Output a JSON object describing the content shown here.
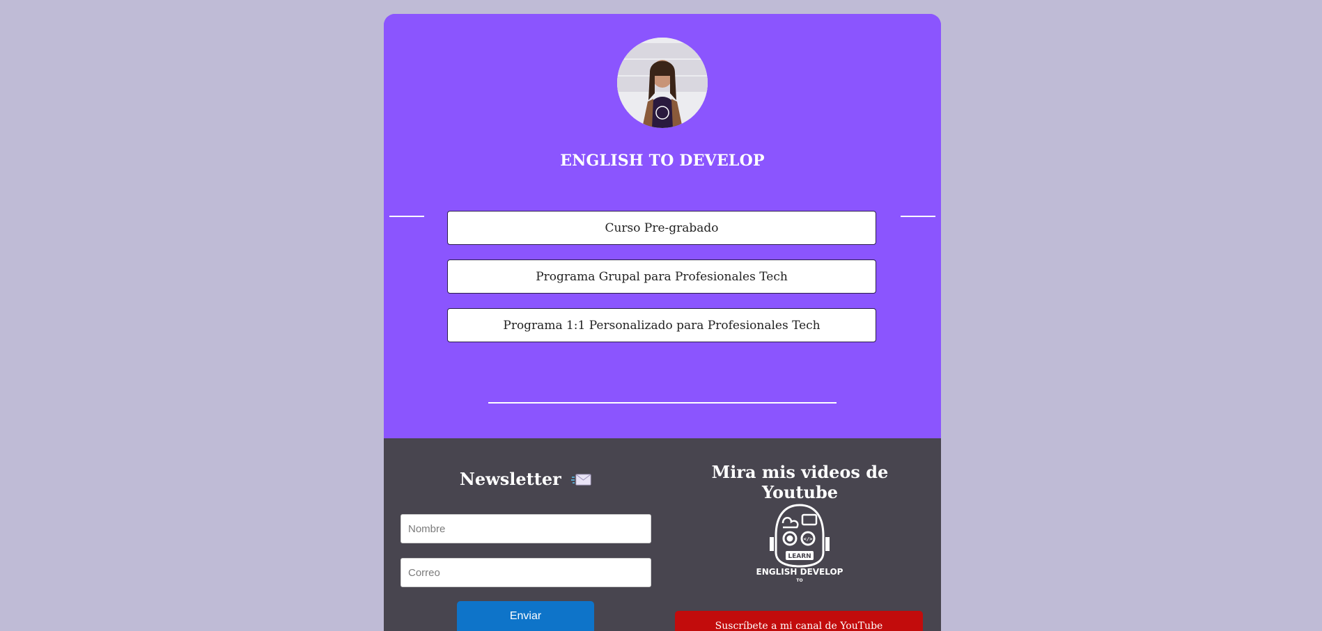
{
  "header": {
    "brand_title": "ENGLISH TO DEVELOP",
    "avatar_alt_icon": "profile-photo"
  },
  "links": [
    {
      "label": "Curso Pre-grabado"
    },
    {
      "label": "Programa Grupal para Profesionales Tech"
    },
    {
      "label": "Programa 1:1 Personalizado para Profesionales Tech"
    }
  ],
  "newsletter": {
    "title": "Newsletter",
    "icon": "envelope-icon",
    "name_placeholder": "Nombre",
    "email_placeholder": "Correo",
    "submit_label": "Enviar"
  },
  "youtube": {
    "title": "Mira mis videos de Youtube",
    "logo_text_main": "ENGLISH DEVELOP",
    "logo_text_small": "TO",
    "logo_badge": "LEARN",
    "subscribe_label": "Suscríbete a mi canal de YouTube"
  },
  "colors": {
    "page_bg": "#bfbbd6",
    "card_purple": "#8b55fe",
    "footer_dark": "#48454f",
    "send_blue": "#0e74c9",
    "youtube_red": "#c20c0c"
  }
}
